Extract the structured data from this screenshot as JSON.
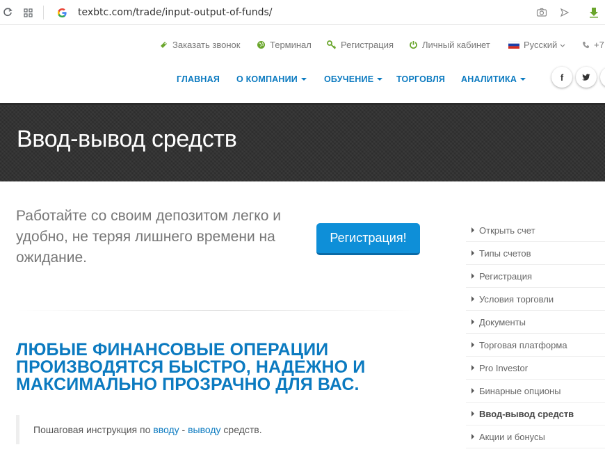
{
  "browser": {
    "url": "texbtc.com/trade/input-output-of-funds/"
  },
  "top_bar": {
    "callback": "Заказать звонок",
    "terminal": "Терминал",
    "registration": "Регистрация",
    "cabinet": "Личный кабинет",
    "language": "Русский",
    "phone": "+7"
  },
  "nav": {
    "items": [
      {
        "label": "ГЛАВНАЯ"
      },
      {
        "label": "О КОМПАНИИ"
      },
      {
        "label": "ОБУЧЕНИЕ"
      },
      {
        "label": "ТОРГОВЛЯ"
      },
      {
        "label": "АНАЛИТИКА"
      }
    ],
    "social": {
      "facebook": "f",
      "twitter": "t"
    }
  },
  "page": {
    "title": "Ввод-вывод средств",
    "intro": "Работайте со своим депозитом легко и удобно, не теряя лишнего времени на ожидание.",
    "register_button": "Регистрация!",
    "heading": "ЛЮБЫЕ ФИНАНСОВЫЕ ОПЕРАЦИИ ПРОИЗВОДЯТСЯ БЫСТРО, НАДЕЖНО И МАКСИМАЛЬНО ПРОЗРАЧНО ДЛЯ ВАС.",
    "quote": {
      "before": "Пошаговая инструкция по ",
      "link1": "вводу",
      "dash": " - ",
      "link2": "выводу",
      "after": " средств."
    }
  },
  "sidebar": {
    "items": [
      {
        "label": "Открыть счет"
      },
      {
        "label": "Типы счетов"
      },
      {
        "label": "Регистрация"
      },
      {
        "label": "Условия торговли"
      },
      {
        "label": "Документы"
      },
      {
        "label": "Торговая платформа"
      },
      {
        "label": "Pro Investor"
      },
      {
        "label": "Бинарные опционы"
      },
      {
        "label": "Ввод-вывод средств"
      },
      {
        "label": "Акции и бонусы"
      }
    ]
  },
  "colors": {
    "brand_blue": "#0b7ac0",
    "button_blue": "#0e8fd8",
    "icon_green": "#6aa62c"
  }
}
